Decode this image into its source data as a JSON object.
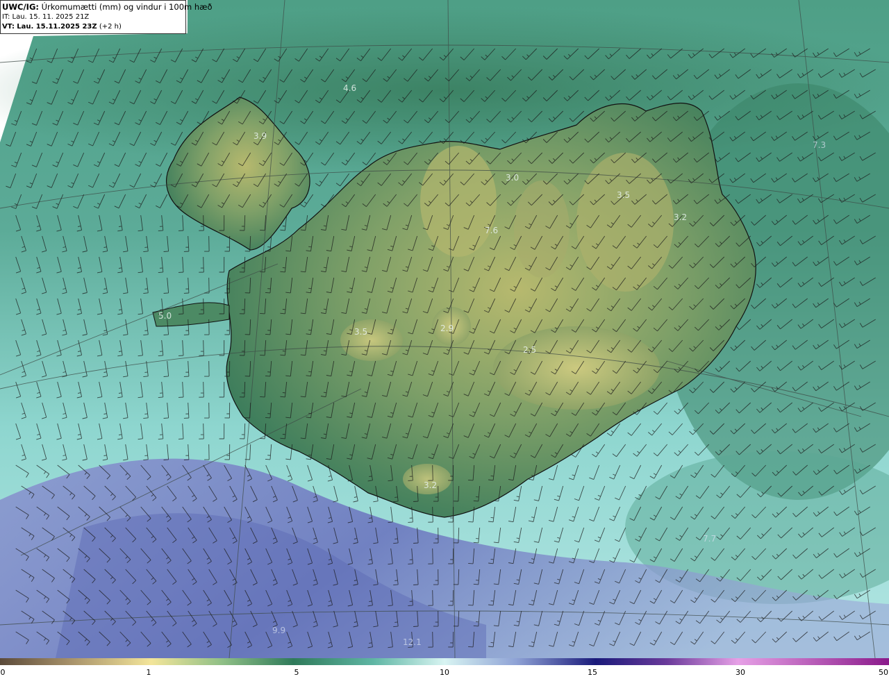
{
  "header": {
    "product": "UWC/IG:",
    "title": "Úrkomumætti (mm) og vindur i 100m hæð",
    "init_label": "IT:",
    "init_time": "Lau. 15. 11. 2025 21Z",
    "valid_label": "VT:",
    "valid_time": "Lau. 15.11.2025 23Z",
    "lead": "(+2 h)"
  },
  "colors": {
    "ocean_base": "#62b5a5",
    "land_low": "#2f7a5a",
    "land_high": "#c9c87a",
    "rain_band": "#7b86c4",
    "coastline": "#111111",
    "barb": "#1a1a1a"
  },
  "colorbar": {
    "ticks": [
      "0",
      "1",
      "5",
      "10",
      "15",
      "30",
      "50"
    ],
    "stops": [
      {
        "at": 0.0,
        "color": "#5b4a3a"
      },
      {
        "at": 0.08,
        "color": "#a8926a"
      },
      {
        "at": 0.17,
        "color": "#f3e59a"
      },
      {
        "at": 0.25,
        "color": "#8fbf86"
      },
      {
        "at": 0.33,
        "color": "#2f7a5a"
      },
      {
        "at": 0.42,
        "color": "#5fb6a4"
      },
      {
        "at": 0.5,
        "color": "#d8f4f2"
      },
      {
        "at": 0.58,
        "color": "#8fa3d6"
      },
      {
        "at": 0.67,
        "color": "#1a1a7a"
      },
      {
        "at": 0.75,
        "color": "#6a3a9a"
      },
      {
        "at": 0.83,
        "color": "#e6a0e6"
      },
      {
        "at": 1.0,
        "color": "#8a1a8a"
      }
    ]
  },
  "map_labels": [
    "4.6",
    "3.9",
    "3.0",
    "7.3",
    "3.5",
    "3.2",
    "7.6",
    "5.0",
    "3.5",
    "2.9",
    "2.5",
    "3.2",
    "7.7",
    "9.9",
    "12.1"
  ]
}
